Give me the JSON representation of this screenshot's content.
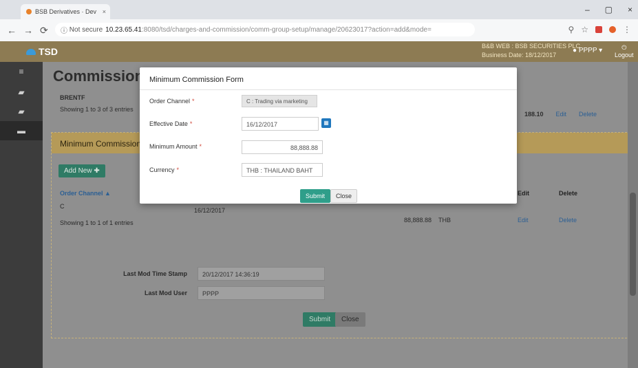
{
  "browser": {
    "tab_title": "BSB Derivatives · Dev",
    "tab_close": "×",
    "security": "Not secure",
    "url_host": "10.23.65.41",
    "url_path": ":8080/tsd/charges-and-commission/comm-group-setup/manage/20623017?action=add&mode=",
    "win_minimize": "–",
    "win_maximize": "▢",
    "win_close": "×"
  },
  "app": {
    "logo": "TSD",
    "bank_name": "B&B WEB : BSB SECURITIES PLC",
    "business_date": "Business Date: 18/12/2017",
    "user": "PPPP ▾",
    "logout": "Logout"
  },
  "page": {
    "title": "Commission G",
    "group_code": "BRENTF",
    "showing": "Showing 1 to 3 of 3 entries",
    "row_amount": "188.10",
    "edit": "Edit",
    "delete": "Delete"
  },
  "panel": {
    "title": "Minimum Commission",
    "add_new": "Add New ✚",
    "columns": {
      "order_channel": "Order Channel ▲",
      "edit": "Edit",
      "delete": "Delete"
    },
    "row": {
      "channel": "C",
      "date": "16/12/2017",
      "amount": "88,888.88",
      "currency": "THB",
      "edit": "Edit",
      "delete": "Delete"
    },
    "showing": "Showing 1 to 1 of 1 entries"
  },
  "meta": {
    "last_mod_time_label": "Last Mod Time Stamp",
    "last_mod_time_value": "20/12/2017 14:36:19",
    "last_mod_user_label": "Last Mod User",
    "last_mod_user_value": "PPPP",
    "submit": "Submit",
    "close": "Close"
  },
  "modal": {
    "title": "Minimum Commission Form",
    "order_channel_label": "Order Channel",
    "order_channel_value": "C : Trading via marketing",
    "effective_date_label": "Effective Date",
    "effective_date_value": "16/12/2017",
    "minimum_amount_label": "Minimum Amount",
    "minimum_amount_value": "88,888.88",
    "currency_label": "Currency",
    "currency_value": "THB : THAILAND BAHT",
    "required_mark": "*",
    "submit": "Submit",
    "close": "Close"
  },
  "colors": {
    "appbar": "#8d7b53",
    "panel_header": "#b59a58",
    "submit_green": "#2f9e8a",
    "link_blue": "#2b5f94"
  }
}
